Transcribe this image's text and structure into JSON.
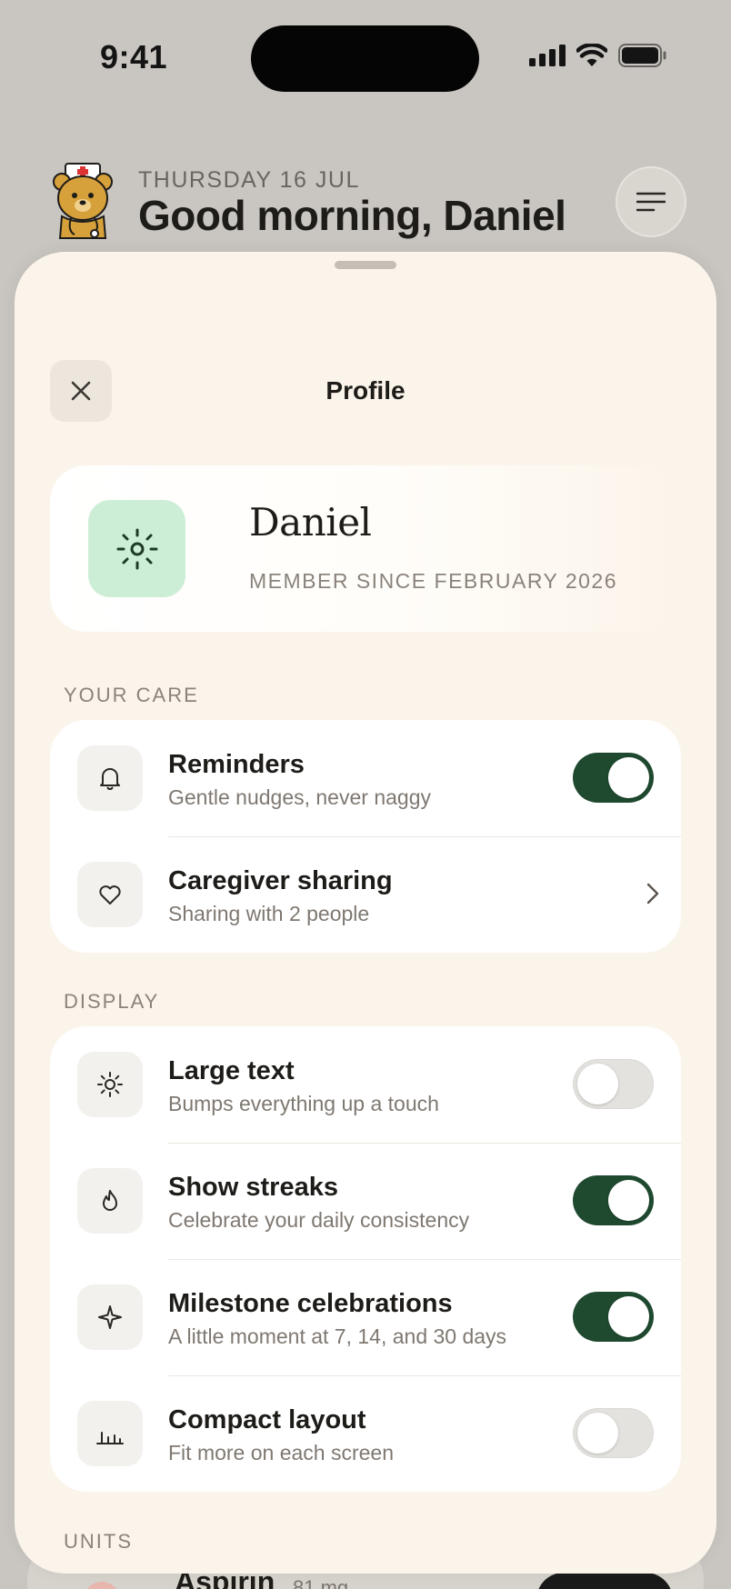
{
  "status_bar": {
    "time": "9:41"
  },
  "header": {
    "date": "THURSDAY 16 JUL",
    "greeting": "Good morning, Daniel"
  },
  "sheet": {
    "title": "Profile",
    "profile": {
      "name": "Daniel",
      "member_since": "MEMBER SINCE FEBRUARY 2026",
      "avatar_icon": "sun-icon"
    },
    "sections": {
      "your_care": "YOUR CARE",
      "display": "DISPLAY",
      "units": "UNITS"
    },
    "care_items": [
      {
        "icon": "bell-icon",
        "title": "Reminders",
        "subtitle": "Gentle nudges, never naggy",
        "control": "toggle",
        "on": true
      },
      {
        "icon": "heart-icon",
        "title": "Caregiver sharing",
        "subtitle": "Sharing with 2 people",
        "control": "chevron"
      }
    ],
    "display_items": [
      {
        "icon": "sun-icon",
        "title": "Large text",
        "subtitle": "Bumps everything up a touch",
        "control": "toggle",
        "on": false
      },
      {
        "icon": "flame-icon",
        "title": "Show streaks",
        "subtitle": "Celebrate your daily consistency",
        "control": "toggle",
        "on": true
      },
      {
        "icon": "sparkle-icon",
        "title": "Milestone celebrations",
        "subtitle": "A little moment at 7, 14, and 30 days",
        "control": "toggle",
        "on": true
      },
      {
        "icon": "bar-chart-icon",
        "title": "Compact layout",
        "subtitle": "Fit more on each screen",
        "control": "toggle",
        "on": false
      }
    ]
  },
  "background_card": {
    "name": "Aspirin",
    "dose": "81 mg"
  },
  "colors": {
    "accent": "#1f4a30",
    "sheet_bg": "#fbf4ea",
    "avatar_bg": "#cdeed6",
    "backdrop": "#c9c5c0"
  }
}
